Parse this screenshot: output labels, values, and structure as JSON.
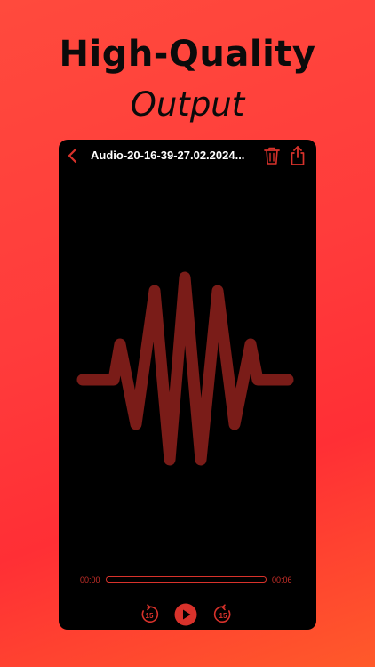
{
  "promo": {
    "headline": "High-Quality",
    "subline": "Output"
  },
  "player": {
    "title": "Audio-20-16-39-27.02.2024...",
    "icons": {
      "back": "chevron-left-icon",
      "trash": "trash-icon",
      "share": "share-icon",
      "rewind": "rewind-15-icon",
      "play": "play-icon",
      "forward": "forward-15-icon"
    },
    "time_elapsed": "00:00",
    "time_total": "00:06",
    "progress": 0,
    "skip_seconds": "15"
  },
  "colors": {
    "accent": "#d8322b",
    "waveform": "#7a1c18",
    "background_gradient_start": "#ff4a3d",
    "background_gradient_end": "#ff5a2a"
  }
}
